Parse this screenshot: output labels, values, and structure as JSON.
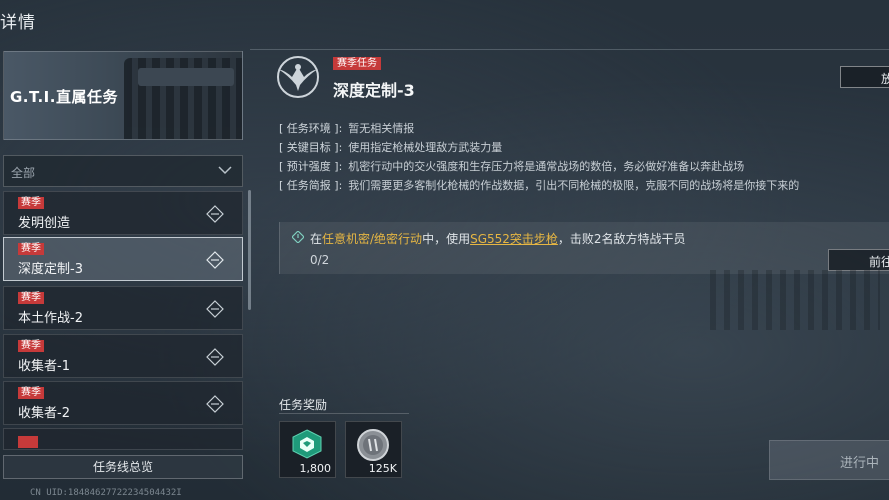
{
  "header": {
    "title": "详情"
  },
  "banner": {
    "title": "G.T.I.直属任务"
  },
  "filter": {
    "selected": "全部"
  },
  "missions": [
    {
      "tag": "赛季",
      "name": "发明创造",
      "active": false
    },
    {
      "tag": "赛季",
      "name": "深度定制-3",
      "active": true
    },
    {
      "tag": "赛季",
      "name": "本土作战-2",
      "active": false
    },
    {
      "tag": "赛季",
      "name": "收集者-1",
      "active": false
    },
    {
      "tag": "赛季",
      "name": "收集者-2",
      "active": false
    }
  ],
  "overview_button": "任务线总览",
  "uid": "CN UID:18484627722234504432I",
  "detail": {
    "tag": "赛季任务",
    "title": "深度定制-3",
    "share_label": "放",
    "info": [
      {
        "key": "[ 任务环境 ]:",
        "value": "暂无相关情报"
      },
      {
        "key": "[ 关键目标 ]:",
        "value": "使用指定枪械处理敌方武装力量"
      },
      {
        "key": "[ 预计强度 ]:",
        "value": "机密行动中的交火强度和生存压力将是通常战场的数倍，务必做好准备以奔赴战场"
      },
      {
        "key": "[ 任务简报 ]:",
        "value": "我们需要更多客制化枪械的作战数据，引出不同枪械的极限，克服不同的战场将是你接下来的"
      }
    ],
    "objective": {
      "prefix": "在",
      "mode": "任意机密/绝密行动",
      "middle": "中，使用",
      "weapon": "SG552突击步枪",
      "suffix": "，击败2名敌方特战干员",
      "progress": "0/2",
      "goto_label": "前往"
    },
    "rewards": {
      "title": "任务奖励",
      "items": [
        {
          "icon": "green-badge-icon",
          "qty": "1,800"
        },
        {
          "icon": "silver-coin-icon",
          "qty": "125K"
        }
      ]
    },
    "status_button": "进行中"
  },
  "colors": {
    "season_red": "#c63a3a",
    "highlight_yellow": "#e6b643"
  }
}
